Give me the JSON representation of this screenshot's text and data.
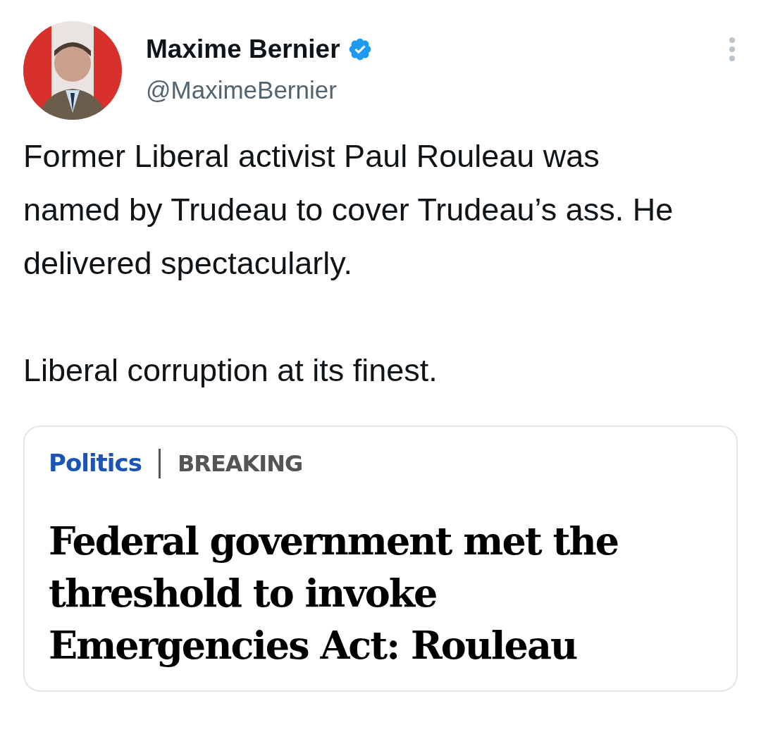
{
  "author": {
    "name": "Maxime Bernier",
    "verified": true,
    "handle": "@MaximeBernier"
  },
  "tweet": {
    "paragraphs": [
      "Former Liberal activist Paul Rouleau was named by Trudeau to cover Trudeau’s ass. He delivered spectacularly.",
      "Liberal corruption at its finest."
    ]
  },
  "card": {
    "section": "Politics",
    "tag": "BREAKING",
    "headline": "Federal government met the threshold to invoke Emergencies Act: Rouleau"
  }
}
